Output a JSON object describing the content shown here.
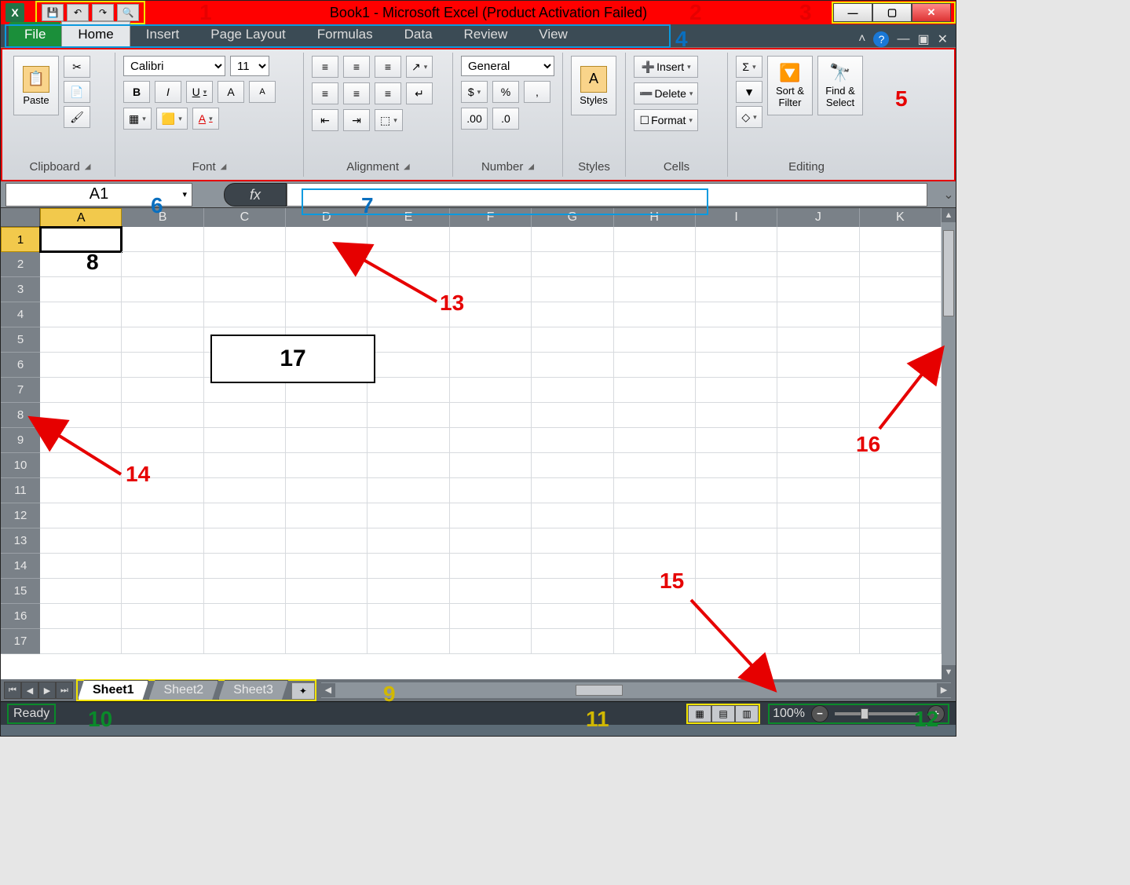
{
  "title": "Book1  -  Microsoft Excel (Product Activation Failed)",
  "qat": {
    "save": "💾",
    "undo": "↶",
    "redo": "↷",
    "preview": "🔍"
  },
  "win": {
    "min": "—",
    "max": "▢",
    "close": "✕"
  },
  "tabs": {
    "file": "File",
    "home": "Home",
    "insert": "Insert",
    "page_layout": "Page Layout",
    "formulas": "Formulas",
    "data": "Data",
    "review": "Review",
    "view": "View"
  },
  "ribbon_right": {
    "collapse": "˄",
    "help": "?",
    "min": "—",
    "restore": "▣",
    "close": "✕"
  },
  "ribbon": {
    "clipboard": {
      "label": "Clipboard",
      "paste": "Paste",
      "cut": "✂",
      "copy": "📄",
      "fmt": "🖌"
    },
    "font": {
      "label": "Font",
      "name": "Calibri",
      "size": "11",
      "bold": "B",
      "italic": "I",
      "underline": "U",
      "grow": "A",
      "shrink": "A",
      "border": "▦",
      "fill": "🟨",
      "color": "A"
    },
    "alignment": {
      "label": "Alignment",
      "top": "≡",
      "mid": "≡",
      "bot": "≡",
      "left": "≡",
      "center": "≡",
      "right": "≡",
      "wrap": "↵",
      "merge": "⬚",
      "dec": "⇤",
      "inc": "⇥",
      "orient": "↗"
    },
    "number": {
      "label": "Number",
      "format": "General",
      "currency": "$",
      "percent": "%",
      "comma": ",",
      "decinc": ".00",
      "decdec": ".0"
    },
    "styles": {
      "label": "Styles",
      "btn": "Styles"
    },
    "cells": {
      "label": "Cells",
      "insert": "Insert",
      "delete": "Delete",
      "format": "Format"
    },
    "editing": {
      "label": "Editing",
      "sum": "Σ",
      "fill": "▼",
      "clear": "◇",
      "sort": "Sort &\nFilter",
      "find": "Find &\nSelect"
    }
  },
  "namebox": "A1",
  "fx": "fx",
  "formula": "",
  "columns": [
    "A",
    "B",
    "C",
    "D",
    "E",
    "F",
    "G",
    "H",
    "I",
    "J",
    "K"
  ],
  "rows": [
    "1",
    "2",
    "3",
    "4",
    "5",
    "6",
    "7",
    "8",
    "9",
    "10",
    "11",
    "12",
    "13",
    "14",
    "15",
    "16",
    "17"
  ],
  "active_cell": "A1",
  "sheets": {
    "s1": "Sheet1",
    "s2": "Sheet2",
    "s3": "Sheet3"
  },
  "status": {
    "ready": "Ready",
    "zoom": "100%"
  },
  "annotations": {
    "n1": "1",
    "n2": "2",
    "n3": "3",
    "n4": "4",
    "n5": "5",
    "n6": "6",
    "n7": "7",
    "n8": "8",
    "n9": "9",
    "n10": "10",
    "n11": "11",
    "n12": "12",
    "n13": "13",
    "n14": "14",
    "n15": "15",
    "n16": "16",
    "n17": "17"
  }
}
